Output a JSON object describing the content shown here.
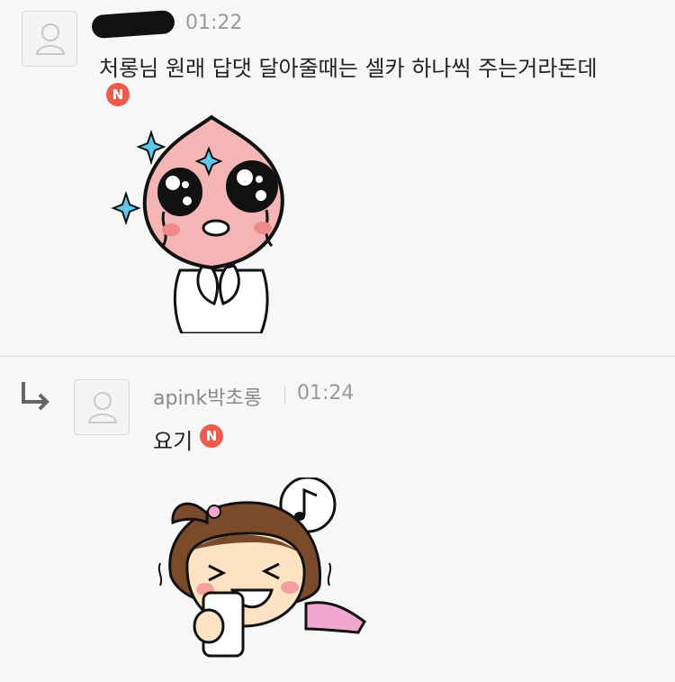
{
  "comments": [
    {
      "time": "01:22",
      "text": "처롱님 원래 답댓 달아줄때는 셀카 하나씩 주는거라돈데",
      "badge": "N",
      "avatar_icon": "default-user-icon",
      "sticker": "crying-peach-sticker"
    }
  ],
  "reply": {
    "nickname": "apink박초롱",
    "time": "01:24",
    "text": "요기",
    "badge": "N",
    "avatar_icon": "default-user-icon",
    "sticker": "girl-selfie-sticker",
    "reply_icon": "reply-arrow-icon"
  },
  "colors": {
    "background": "#f7f7f7",
    "badge": "#ee5a4b",
    "time_text": "#9a9a9a",
    "divider": "#dcdcdc"
  }
}
